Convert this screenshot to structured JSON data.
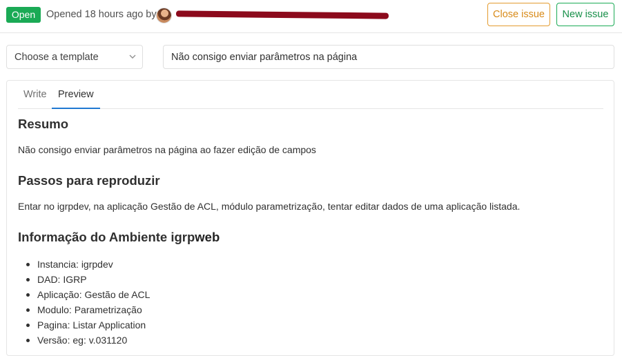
{
  "header": {
    "status": "Open",
    "opened_text": "Opened 18 hours ago by",
    "close_issue": "Close issue",
    "new_issue": "New issue"
  },
  "form": {
    "template_placeholder": "Choose a template",
    "title_value": "Não consigo enviar parâmetros na página"
  },
  "tabs": {
    "write": "Write",
    "preview": "Preview"
  },
  "preview": {
    "h1": "Resumo",
    "p1": "Não consigo enviar parâmetros na página ao fazer edição de campos",
    "h2": "Passos para reproduzir",
    "p2": "Entar no igrpdev, na aplicação Gestão de ACL, módulo parametrização, tentar editar dados de uma aplicação listada.",
    "h3_prefix": "Informação do Ambiente igrp",
    "h3_bold": "web",
    "env_items": [
      "Instancia: igrpdev",
      "DAD: IGRP",
      "Aplicação: Gestão de ACL",
      "Modulo: Parametrização",
      "Pagina: Listar Application",
      "Versão: eg: v.031120"
    ]
  },
  "colors": {
    "open_badge": "#1aaa55",
    "close_issue_border": "#e39b2e",
    "new_issue_border": "#1aaa55",
    "active_tab_underline": "#1f78d1",
    "redaction": "#8c0a1c"
  },
  "icons": {
    "select_chevron": "chevron-down-icon"
  }
}
